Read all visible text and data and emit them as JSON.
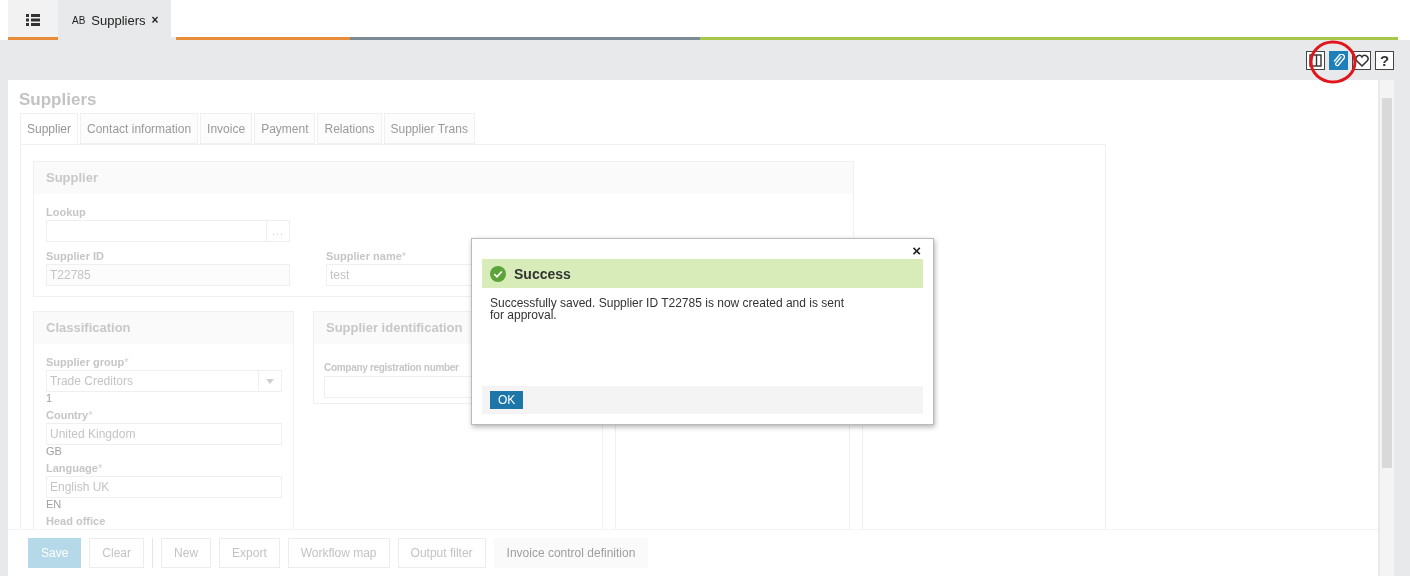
{
  "app_tabs": [
    {
      "prefix": "AB",
      "label": "Suppliers",
      "close": "×",
      "selected": true
    }
  ],
  "toolbar": [
    {
      "kind": "panel",
      "active": false
    },
    {
      "kind": "attach",
      "active": true
    },
    {
      "kind": "favorite",
      "active": false
    },
    {
      "kind": "help",
      "label": "?",
      "active": false
    }
  ],
  "page_title": "Suppliers",
  "form_tabs": [
    {
      "label": "Supplier",
      "selected": true
    },
    {
      "label": "Contact information",
      "selected": false
    },
    {
      "label": "Invoice",
      "selected": false
    },
    {
      "label": "Payment",
      "selected": false
    },
    {
      "label": "Relations",
      "selected": false
    },
    {
      "label": "Supplier Trans",
      "selected": false
    }
  ],
  "supplier_section": {
    "title": "Supplier",
    "lookup": {
      "label": "Lookup",
      "button": "..."
    },
    "supplier_id": {
      "label": "Supplier ID",
      "value": "T22785"
    },
    "supplier_name": {
      "label": "Supplier name",
      "required": "*",
      "value": "test"
    }
  },
  "classification": {
    "title": "Classification",
    "fields": [
      {
        "label": "Supplier group",
        "required": "*",
        "value": "Trade Creditors",
        "hint": "1",
        "kind": "dropdown"
      },
      {
        "label": "Country",
        "required": "*",
        "value": "United Kingdom",
        "hint": "GB",
        "kind": "text"
      },
      {
        "label": "Language",
        "required": "*",
        "value": "English UK",
        "hint": "EN",
        "kind": "text"
      }
    ],
    "next_label": "Head office"
  },
  "supplier_identification": {
    "title": "Supplier identification",
    "field_label": "Company registration number"
  },
  "actions": [
    {
      "label": "Save",
      "kind": "primary"
    },
    {
      "label": "Clear",
      "kind": "default"
    },
    {
      "kind": "separator"
    },
    {
      "label": "New",
      "kind": "default"
    },
    {
      "label": "Export",
      "kind": "default"
    },
    {
      "label": "Workflow map",
      "kind": "default"
    },
    {
      "label": "Output filter",
      "kind": "default"
    },
    {
      "label": "Invoice control definition",
      "kind": "disabled"
    }
  ],
  "dialog": {
    "close": "×",
    "title": "Success",
    "message": "Successfully saved. Supplier ID T22785 is now created and is sent for approval.",
    "button": "OK"
  }
}
